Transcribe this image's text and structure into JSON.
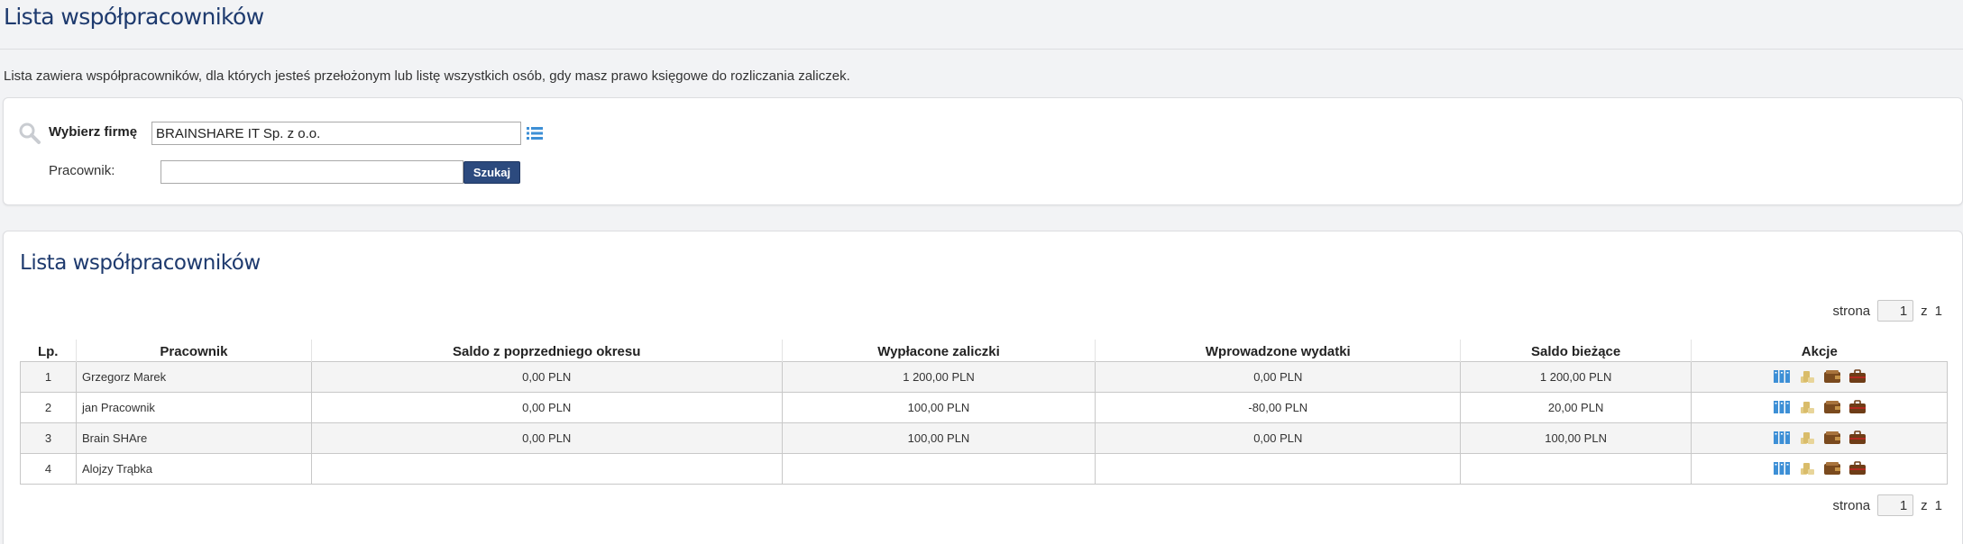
{
  "page": {
    "title": "Lista współpracowników",
    "intro": "Lista zawiera współpracowników, dla których jesteś przełożonym lub listę wszystkich osób, gdy masz prawo księgowe do rozliczania zaliczek."
  },
  "filter": {
    "company_label": "Wybierz firmę",
    "company_value": "BRAINSHARE IT Sp. z o.o.",
    "employee_label": "Pracownik:",
    "employee_value": "",
    "search_button": "Szukaj"
  },
  "list": {
    "title": "Lista współpracowników",
    "pager": {
      "label": "strona",
      "page": "1",
      "of_label": "z",
      "total": "1"
    },
    "columns": [
      "Lp.",
      "Pracownik",
      "Saldo z poprzedniego okresu",
      "Wypłacone zaliczki",
      "Wprowadzone wydatki",
      "Saldo bieżące",
      "Akcje"
    ],
    "rows": [
      {
        "lp": "1",
        "name": "Grzegorz Marek",
        "prev_balance": "0,00 PLN",
        "advances": "1 200,00 PLN",
        "expenses": "0,00 PLN",
        "current_balance": "1 200,00 PLN"
      },
      {
        "lp": "2",
        "name": "jan Pracownik",
        "prev_balance": "0,00 PLN",
        "advances": "100,00 PLN",
        "expenses": "-80,00 PLN",
        "current_balance": "20,00 PLN"
      },
      {
        "lp": "3",
        "name": "Brain SHAre",
        "prev_balance": "0,00 PLN",
        "advances": "100,00 PLN",
        "expenses": "0,00 PLN",
        "current_balance": "100,00 PLN"
      },
      {
        "lp": "4",
        "name": "Alojzy Trąbka",
        "prev_balance": "",
        "advances": "",
        "expenses": "",
        "current_balance": ""
      }
    ],
    "action_icons": [
      "documents-icon",
      "coins-icon",
      "wallet-icon",
      "briefcase-icon"
    ]
  },
  "colors": {
    "brand": "#1e3a6e",
    "button": "#2c4a7e",
    "action_blue": "#3d8fd6",
    "coin": "#d9bc6a",
    "wallet": "#7a4a1e"
  }
}
